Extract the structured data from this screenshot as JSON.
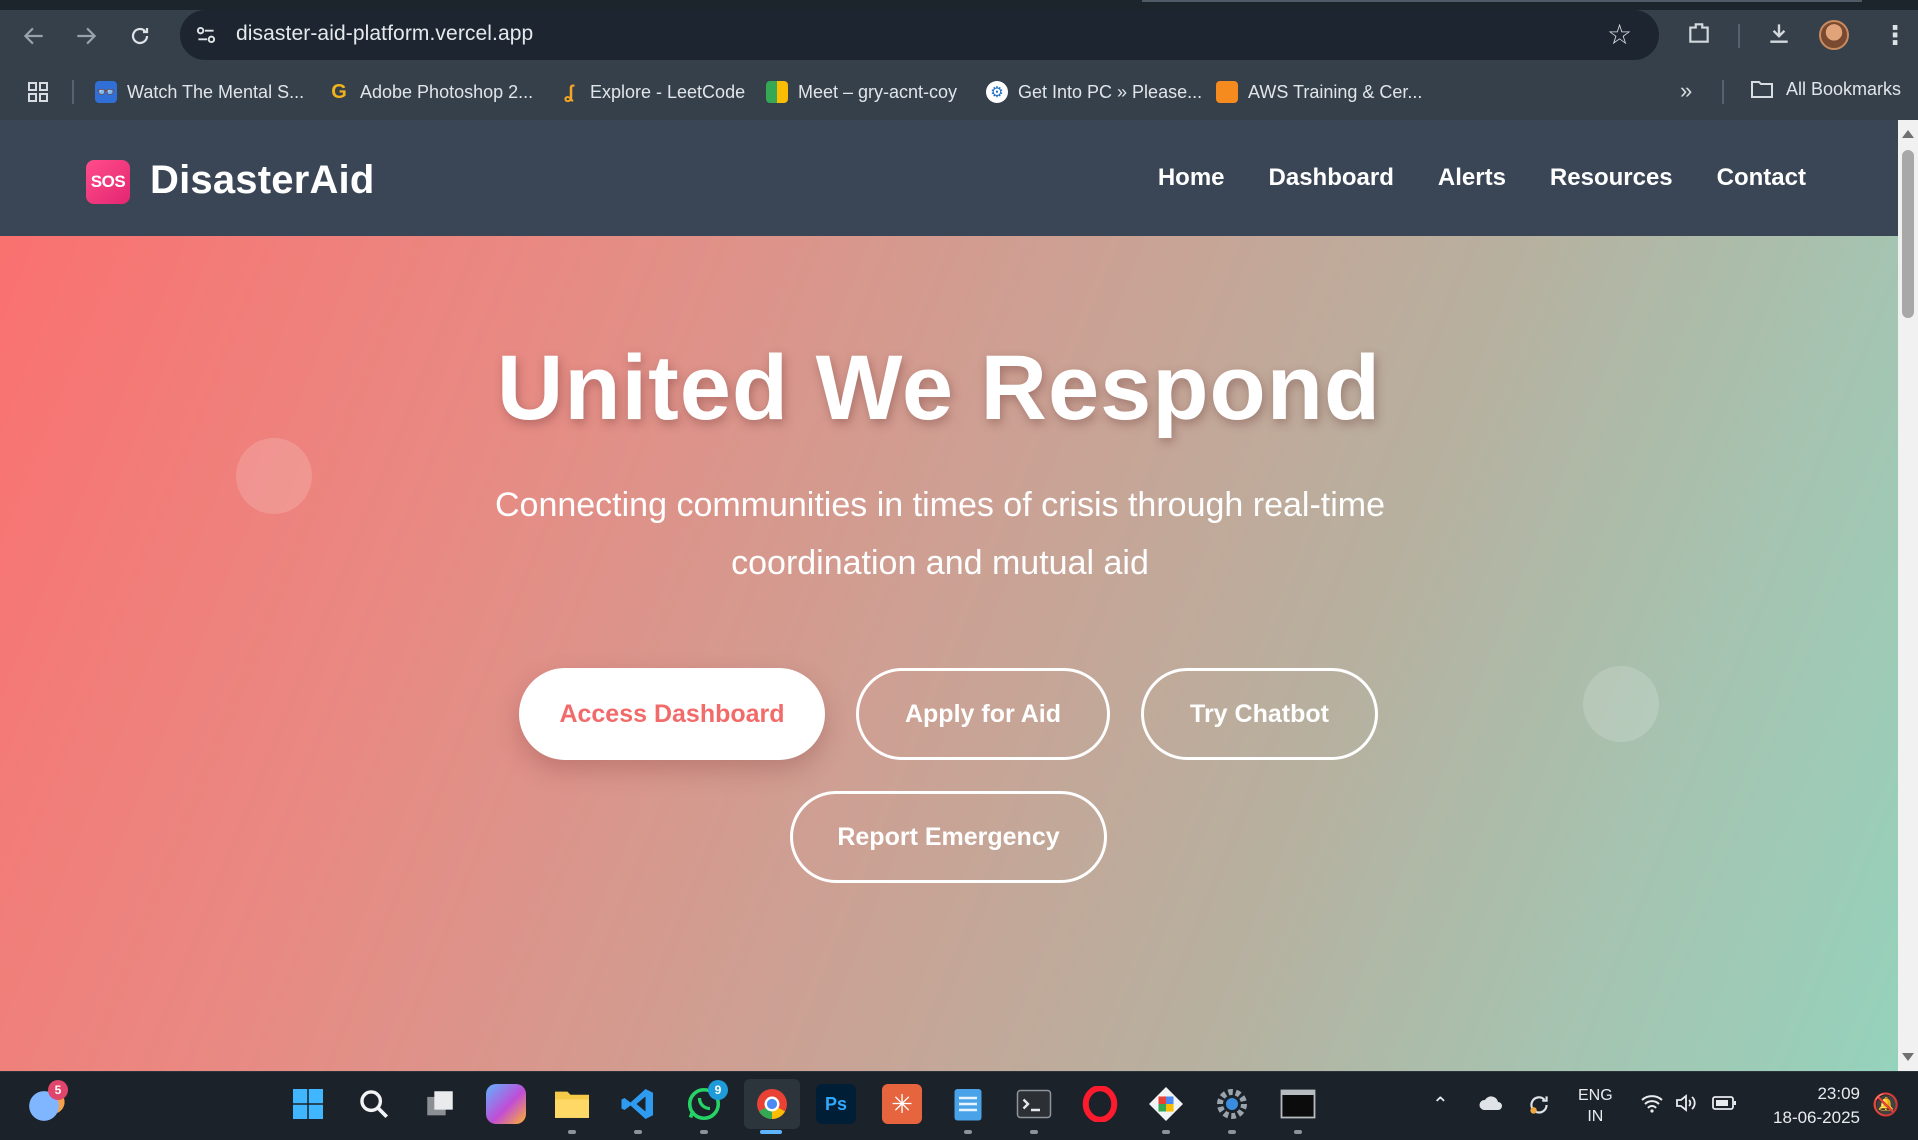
{
  "browser": {
    "url": "disaster-aid-platform.vercel.app",
    "bookmarks": [
      {
        "label": "Watch The Mental S...",
        "icon": "binoculars-icon"
      },
      {
        "label": "Adobe Photoshop 2...",
        "icon": "g-letter-icon"
      },
      {
        "label": "Explore - LeetCode",
        "icon": "leetcode-icon"
      },
      {
        "label": "Meet – gry-acnt-coy",
        "icon": "google-meet-icon"
      },
      {
        "label": "Get Into PC » Please...",
        "icon": "getintopc-icon"
      },
      {
        "label": "AWS Training & Cer...",
        "icon": "aws-cube-icon"
      }
    ],
    "all_bookmarks": "All Bookmarks"
  },
  "site": {
    "logo_badge": "SOS",
    "logo_text": "DisasterAid",
    "nav": [
      "Home",
      "Dashboard",
      "Alerts",
      "Resources",
      "Contact"
    ],
    "hero": {
      "title": "United We Respond",
      "subtitle": "Connecting communities in times of crisis through real-time coordination and mutual aid",
      "buttons": [
        "Access Dashboard",
        "Apply for Aid",
        "Try Chatbot",
        "Report Emergency"
      ]
    },
    "colors": {
      "nav_bg": "#3a4656",
      "hero_gradient_start": "#fa7170",
      "hero_gradient_end": "#95d2bc",
      "primary_button_text": "#f26b6b",
      "logo_badge": "#e32672"
    }
  },
  "taskbar": {
    "weather_badge": "5",
    "whatsapp_badge": "9",
    "language": "ENG",
    "region": "IN",
    "time": "23:09",
    "date": "18-06-2025",
    "apps": [
      "start-icon",
      "search-icon",
      "task-view-icon",
      "copilot-icon",
      "file-explorer-icon",
      "vscode-icon",
      "whatsapp-icon",
      "chrome-icon",
      "photoshop-icon",
      "claude-icon",
      "notepad-icon",
      "terminal-icon",
      "opera-icon",
      "git-icon",
      "settings-icon",
      "cmd-icon"
    ]
  }
}
